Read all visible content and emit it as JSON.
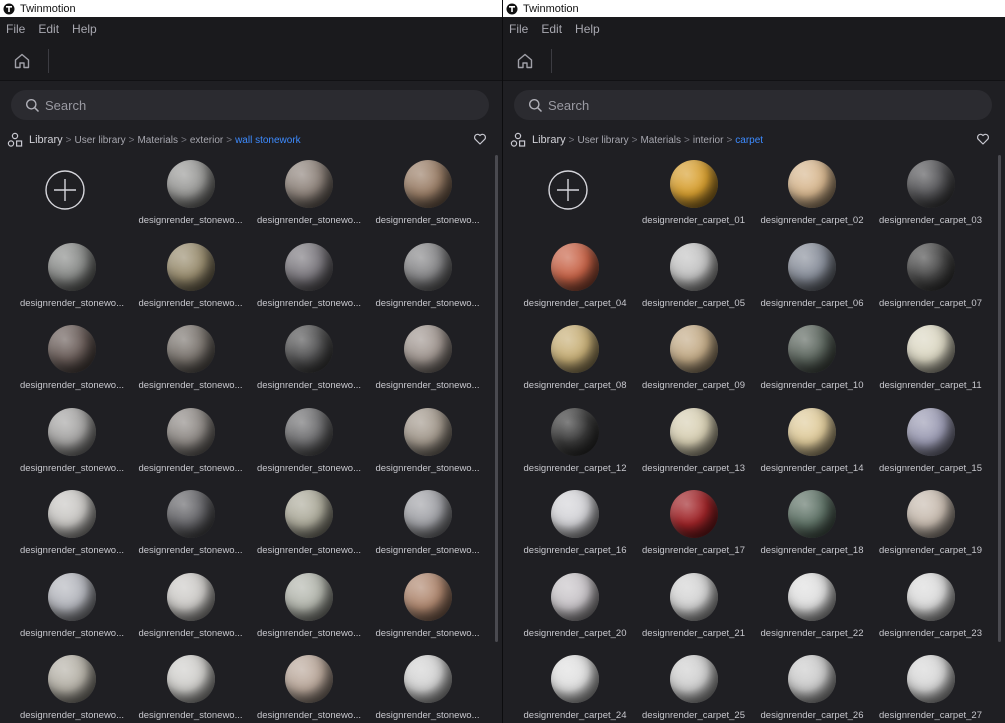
{
  "app_title": "Twinmotion",
  "menu": [
    "File",
    "Edit",
    "Help"
  ],
  "search_placeholder": "Search",
  "colors": {
    "accent": "#3d8bff",
    "panel": "#1f1f23",
    "search": "#2b2b30"
  },
  "left": {
    "breadcrumb": [
      "User library",
      "Materials",
      "exterior"
    ],
    "breadcrumb_root": "Library",
    "breadcrumb_active": "wall stonework",
    "items": [
      {
        "label": "designrender_stonewo...",
        "color": "#9a9a98"
      },
      {
        "label": "designrender_stonewo...",
        "color": "#8f847c"
      },
      {
        "label": "designrender_stonewo...",
        "color": "#9b7f68"
      },
      {
        "label": "designrender_stonewo...",
        "color": "#8a8c8a"
      },
      {
        "label": "designrender_stonewo...",
        "color": "#9a8e70"
      },
      {
        "label": "designrender_stonewo...",
        "color": "#7d7a80"
      },
      {
        "label": "designrender_stonewo...",
        "color": "#88888a"
      },
      {
        "label": "designrender_stonewo...",
        "color": "#6b5e5a"
      },
      {
        "label": "designrender_stonewo...",
        "color": "#7c7670"
      },
      {
        "label": "designrender_stonewo...",
        "color": "#555556"
      },
      {
        "label": "designrender_stonewo...",
        "color": "#a29892"
      },
      {
        "label": "designrender_stonewo...",
        "color": "#a6a5a4"
      },
      {
        "label": "designrender_stonewo...",
        "color": "#8f8a86"
      },
      {
        "label": "designrender_stonewo...",
        "color": "#707072"
      },
      {
        "label": "designrender_stonewo...",
        "color": "#a49a8e"
      },
      {
        "label": "designrender_stonewo...",
        "color": "#c9c7c4"
      },
      {
        "label": "designrender_stonewo...",
        "color": "#66666a"
      },
      {
        "label": "designrender_stonewo...",
        "color": "#aeac9c"
      },
      {
        "label": "designrender_stonewo...",
        "color": "#a2a3a8"
      },
      {
        "label": "designrender_stonewo...",
        "color": "#b5b7be"
      },
      {
        "label": "designrender_stonewo...",
        "color": "#cdcbc8"
      },
      {
        "label": "designrender_stonewo...",
        "color": "#b4b7ae"
      },
      {
        "label": "designrender_stonewo...",
        "color": "#b08870"
      },
      {
        "label": "designrender_stonewo...",
        "color": "#b6b2a8"
      },
      {
        "label": "designrender_stonewo...",
        "color": "#d0cfcc"
      },
      {
        "label": "designrender_stonewo...",
        "color": "#bba99c"
      },
      {
        "label": "designrender_stonewo...",
        "color": "#d4d4d4"
      }
    ]
  },
  "right": {
    "breadcrumb": [
      "User library",
      "Materials",
      "interior"
    ],
    "breadcrumb_root": "Library",
    "breadcrumb_active": "carpet",
    "items": [
      {
        "label": "designrender_carpet_01",
        "color": "#d8a030"
      },
      {
        "label": "designrender_carpet_02",
        "color": "#d8b890"
      },
      {
        "label": "designrender_carpet_03",
        "color": "#57575a"
      },
      {
        "label": "designrender_carpet_04",
        "color": "#c86448"
      },
      {
        "label": "designrender_carpet_05",
        "color": "#c4c4c4"
      },
      {
        "label": "designrender_carpet_06",
        "color": "#8a909c"
      },
      {
        "label": "designrender_carpet_07",
        "color": "#4c4c4c"
      },
      {
        "label": "designrender_carpet_08",
        "color": "#c8b078"
      },
      {
        "label": "designrender_carpet_09",
        "color": "#c4ac88"
      },
      {
        "label": "designrender_carpet_10",
        "color": "#5e6860"
      },
      {
        "label": "designrender_carpet_11",
        "color": "#dcd8c4"
      },
      {
        "label": "designrender_carpet_12",
        "color": "#3c3c3c"
      },
      {
        "label": "designrender_carpet_13",
        "color": "#d8d0b4"
      },
      {
        "label": "designrender_carpet_14",
        "color": "#e0cc9c"
      },
      {
        "label": "designrender_carpet_15",
        "color": "#9c9cb4"
      },
      {
        "label": "designrender_carpet_16",
        "color": "#d4d4d8"
      },
      {
        "label": "designrender_carpet_17",
        "color": "#a02428"
      },
      {
        "label": "designrender_carpet_18",
        "color": "#607468"
      },
      {
        "label": "designrender_carpet_19",
        "color": "#c8bcb0"
      },
      {
        "label": "designrender_carpet_20",
        "color": "#c8c4c8"
      },
      {
        "label": "designrender_carpet_21",
        "color": "#d4d4d4"
      },
      {
        "label": "designrender_carpet_22",
        "color": "#e0e0e0"
      },
      {
        "label": "designrender_carpet_23",
        "color": "#dcdcdc"
      },
      {
        "label": "designrender_carpet_24",
        "color": "#e0e0e0"
      },
      {
        "label": "designrender_carpet_25",
        "color": "#d0d0d0"
      },
      {
        "label": "designrender_carpet_26",
        "color": "#cccccc"
      },
      {
        "label": "designrender_carpet_27",
        "color": "#d8d8d8"
      }
    ]
  }
}
